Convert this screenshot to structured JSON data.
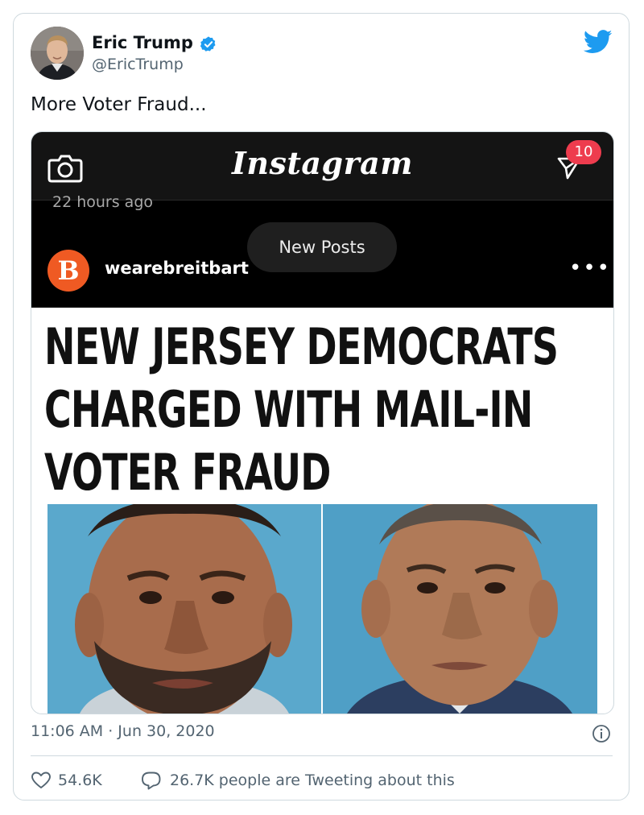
{
  "tweet": {
    "author_name": "Eric Trump",
    "author_handle": "@EricTrump",
    "text": "More Voter Fraud...",
    "timestamp": "11:06 AM · Jun 30, 2020",
    "likes": "54.6K",
    "tweeting_about": "26.7K people are Tweeting about this",
    "accent_color": "#1d9bf0"
  },
  "instagram": {
    "app_title": "Instagram",
    "notification_count": "10",
    "time_ago": "22 hours ago",
    "new_posts_label": "New Posts",
    "account_initial": "B",
    "account_name": "wearebreitbart",
    "more_label": "•••",
    "headline": [
      "NEW JERSEY DEMOCRATS",
      "CHARGED WITH MAIL-IN",
      "VOTER FRAUD"
    ]
  },
  "icons": [
    "verified-icon",
    "twitter-bird-icon",
    "camera-icon",
    "direct-message-icon",
    "info-icon",
    "heart-icon",
    "speech-bubble-icon"
  ]
}
